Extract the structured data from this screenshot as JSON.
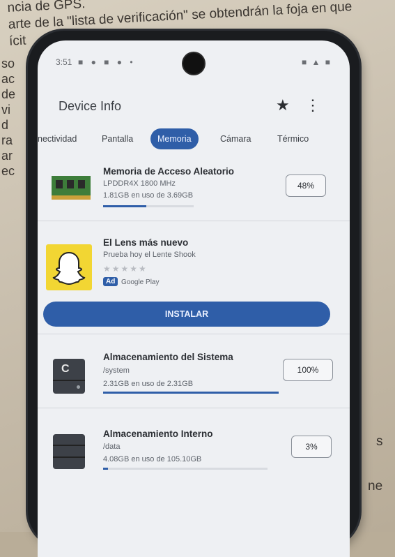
{
  "paper": {
    "lines": [
      "ncia de GPS.",
      "arte de la \"lista de verificación\" se obtendrán",
      "ícit"
    ],
    "left_fragments": [
      "so",
      "ac",
      "de",
      "vi",
      "d",
      "ra",
      "ar",
      "ec"
    ],
    "right_fragments": [
      "s",
      "ne"
    ],
    "line2_tail": "la foja en que"
  },
  "status_bar": {
    "time": "3:51",
    "icons_left": "■ ● ■ ● •",
    "icons_right": "■ ▲ ■"
  },
  "app": {
    "title": "Device Info",
    "star_icon": "star-icon",
    "more_icon": "more-vert-icon"
  },
  "tabs": [
    {
      "label": "nectividad",
      "active": false
    },
    {
      "label": "Pantalla",
      "active": false
    },
    {
      "label": "Memoria",
      "active": true
    },
    {
      "label": "Cámara",
      "active": false
    },
    {
      "label": "Térmico",
      "active": false
    }
  ],
  "ram": {
    "title": "Memoria de Acceso Aleatorio",
    "type": "LPDDR4X 1800 MHz",
    "usage": "1.81GB en uso de 3.69GB",
    "percent_label": "48%",
    "percent": 48
  },
  "ad": {
    "title": "El Lens más nuevo",
    "subtitle": "Prueba hoy el Lente Shook",
    "stars": "★★★★★",
    "ad_label": "Ad",
    "store": "Google Play",
    "install_label": "INSTALAR"
  },
  "system_storage": {
    "title": "Almacenamiento del Sistema",
    "path": "/system",
    "usage": "2.31GB en uso de 2.31GB",
    "percent_label": "100%",
    "percent": 100,
    "drive_letter": "C"
  },
  "internal_storage": {
    "title": "Almacenamiento Interno",
    "path": "/data",
    "usage": "4.08GB en uso de 105.10GB",
    "percent_label": "3%",
    "percent": 3
  },
  "colors": {
    "accent": "#2f5ea8",
    "screen_bg": "#eef0f3",
    "snap_yellow": "#f2d633"
  }
}
